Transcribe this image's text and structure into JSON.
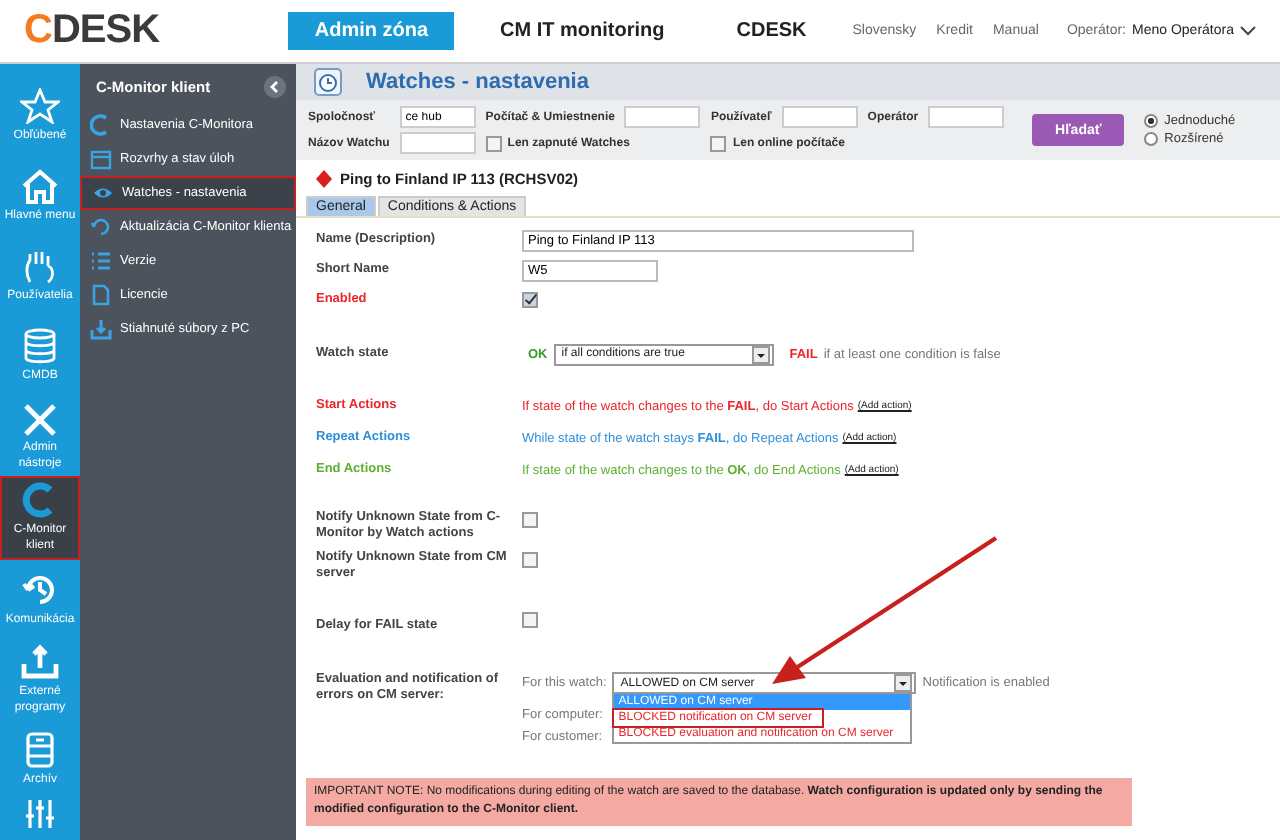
{
  "header": {
    "logo": "CDESK",
    "nav": [
      {
        "label": "Admin zóna",
        "selected": true
      },
      {
        "label": "CM IT monitoring",
        "selected": false
      },
      {
        "label": "CDESK",
        "selected": false
      }
    ],
    "links": [
      "Slovensky",
      "Kredit",
      "Manual"
    ],
    "operator_label": "Operátor:",
    "operator_name": "Meno Operátora"
  },
  "rail": [
    {
      "label": "Obľúbené",
      "selected": false
    },
    {
      "label": "Hlavné menu",
      "selected": false
    },
    {
      "label": "Používatelia",
      "selected": false
    },
    {
      "label": "CMDB",
      "selected": false
    },
    {
      "label": "Admin nástroje",
      "selected": false
    },
    {
      "label": "C-Monitor klient",
      "selected": true
    },
    {
      "label": "Komunikácia",
      "selected": false
    },
    {
      "label": "Externé programy",
      "selected": false
    },
    {
      "label": "Archív",
      "selected": false
    }
  ],
  "sidebar": {
    "title": "C-Monitor klient",
    "items": [
      {
        "label": "Nastavenia C-Monitora",
        "selected": false
      },
      {
        "label": "Rozvrhy a stav úloh",
        "selected": false
      },
      {
        "label": "Watches - nastavenia",
        "selected": true
      },
      {
        "label": "Aktualizácia C-Monitor klienta",
        "selected": false
      },
      {
        "label": "Verzie",
        "selected": false
      },
      {
        "label": "Licencie",
        "selected": false
      },
      {
        "label": "Stiahnuté súbory z PC",
        "selected": false
      }
    ]
  },
  "page": {
    "title": "Watches - nastavenia"
  },
  "filter": {
    "company": {
      "label": "Spoločnosť",
      "value": "ce hub"
    },
    "computer": {
      "label": "Počítač & Umiestnenie"
    },
    "user": {
      "label": "Používateľ"
    },
    "operator": {
      "label": "Operátor"
    },
    "watch_name": {
      "label": "Názov Watchu"
    },
    "checks": [
      {
        "label": "Len zapnuté Watches",
        "checked": false
      },
      {
        "label": "Len online počítače",
        "checked": false
      }
    ],
    "search_button": "Hľadať",
    "modes": [
      {
        "label": "Jednoduché",
        "selected": true
      },
      {
        "label": "Rozšírené",
        "selected": false
      }
    ]
  },
  "watch": {
    "title": "Ping to Finland IP 113 (RCHSV02)"
  },
  "tabs": [
    {
      "label": "General",
      "selected": true
    },
    {
      "label": "Conditions & Actions",
      "selected": false
    }
  ],
  "form": {
    "name": {
      "label": "Name (Description)",
      "value": "Ping to Finland IP 113"
    },
    "short_name": {
      "label": "Short Name",
      "value": "W5"
    },
    "enabled": {
      "label": "Enabled",
      "checked": true
    },
    "watch_state": {
      "label": "Watch state",
      "ok": "OK",
      "select": "if all conditions are true",
      "fail": "FAIL",
      "fail_text": "if at least one condition is false"
    },
    "actions": [
      {
        "kind": "start",
        "label": "Start Actions",
        "text": "If state of the watch changes to the **FAIL**, do Start Actions",
        "link": "(Add action)"
      },
      {
        "kind": "repeat",
        "label": "Repeat Actions",
        "text": "While state of the watch stays **FAIL**, do Repeat Actions",
        "link": "(Add action)"
      },
      {
        "kind": "end",
        "label": "End Actions",
        "text": "If state of the watch changes to the **OK**, do End Actions",
        "link": "(Add action)"
      }
    ],
    "options": [
      {
        "label": "Notify Unknown State from C-Monitor by Watch actions",
        "checked": false
      },
      {
        "label": "Notify Unknown State from CM server",
        "checked": false
      },
      {
        "label": "Delay for FAIL state",
        "checked": false
      }
    ],
    "evaluation": {
      "label": "Evaluation and notification of errors on CM server:",
      "for_watch": "For this watch:",
      "select": "ALLOWED on CM server",
      "status": "Notification is enabled",
      "for_computer": "For computer:",
      "for_customer": "For customer:",
      "dropdown": [
        {
          "label": "ALLOWED on CM server",
          "selected": true,
          "marked": false
        },
        {
          "label": "BLOCKED notification on CM server",
          "kind": "blocked",
          "selected": false,
          "marked": true
        },
        {
          "label": "BLOCKED evaluation and notification on CM server",
          "kind": "blocked",
          "selected": false,
          "marked": false
        }
      ]
    },
    "note": "IMPORTANT NOTE: No modifications during editing of the watch are saved to the database. **Watch configuration is updated only by sending the modified configuration to the C-Monitor client.**"
  }
}
